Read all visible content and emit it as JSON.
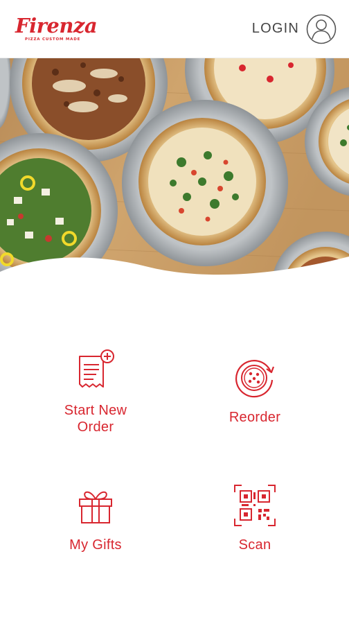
{
  "header": {
    "logo_text": "Firenza",
    "logo_tagline": "PIZZA CUSTOM MADE",
    "login_label": "LOGIN"
  },
  "actions": [
    {
      "label_line1": "Start New",
      "label_line2": "Order",
      "icon": "receipt-plus-icon"
    },
    {
      "label": "Reorder",
      "icon": "pizza-reorder-icon"
    },
    {
      "label": "My Gifts",
      "icon": "gift-icon"
    },
    {
      "label": "Scan",
      "icon": "qr-code-icon"
    }
  ],
  "colors": {
    "brand": "#d8262f",
    "login_text": "#444444",
    "wood": "#c79a63"
  }
}
